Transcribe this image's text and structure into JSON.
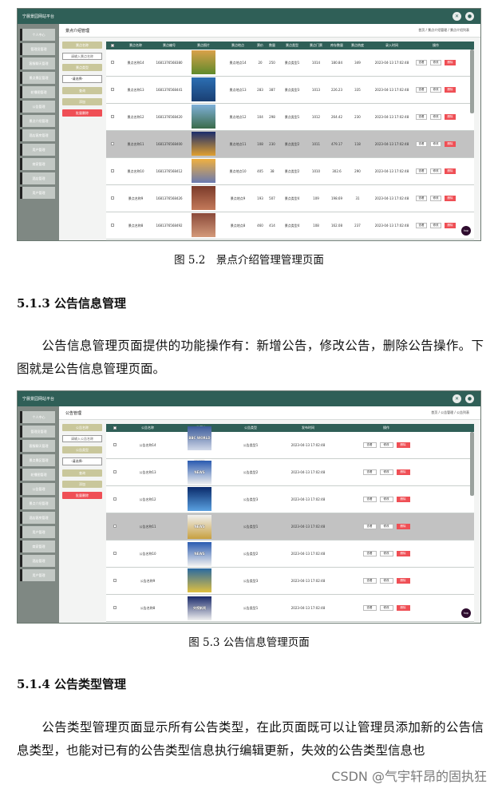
{
  "shot1": {
    "app_title": "宁晨景园网站平台",
    "sidebar": [
      "个人中心",
      "管理员管理",
      "客服聊天管理",
      "景点景区管理",
      "轮播图管理",
      "公告管理",
      "景点介绍管理",
      "酒店客房管理",
      "用户管理",
      "商家管理",
      "酒店管理",
      "用户管理"
    ],
    "page_title": "景点介绍管理",
    "breadcrumb": "首页 / 景点介绍管理 / 景点介绍列表",
    "controls": {
      "btn1": "景点名称",
      "input_placeholder": "请输入景点名称",
      "btn2": "景点类型",
      "select": "-请选择-",
      "btn3": "查询",
      "btn4": "添加",
      "btn5": "批量删除"
    },
    "headers": [
      "景点名称",
      "景点编号",
      "景点照片",
      "景点地点",
      "票价",
      "数量",
      "景点类型",
      "景点门票",
      "库存数量",
      "景点热度",
      "录入时间",
      "操作"
    ],
    "rows": [
      [
        "景点名称14",
        "1681376568380",
        "",
        "景点地点14",
        "20",
        "250",
        "景点类型1",
        "1014",
        "180.84",
        "349",
        "2023-04-13 17:02:48"
      ],
      [
        "景点名称13",
        "1681376568441",
        "",
        "景点地点13",
        "283",
        "387",
        "景点类型3",
        "1013",
        "226.23",
        "335",
        "2023-04-13 17:02:48"
      ],
      [
        "景点名称12",
        "1681376568420",
        "",
        "景点地点12",
        "104",
        "298",
        "景点类型1",
        "1012",
        "264.42",
        "230",
        "2023-04-13 17:02:48"
      ],
      [
        "景点名称11",
        "1681376568400",
        "",
        "景点地点11",
        "108",
        "230",
        "景点类型2",
        "1011",
        "479.17",
        "118",
        "2023-04-13 17:02:48"
      ],
      [
        "景点名称10",
        "1681376568412",
        "",
        "景点地点10",
        "405",
        "38",
        "景点类型2",
        "1010",
        "302.6",
        "290",
        "2023-04-13 17:02:48"
      ],
      [
        "景点名称9",
        "1681376568426",
        "",
        "景点地点9",
        "193",
        "507",
        "景点类型4",
        "109",
        "198.69",
        "31",
        "2023-04-13 17:02:48"
      ],
      [
        "景点名称8",
        "1681376568492",
        "",
        "景点地点8",
        "460",
        "414",
        "景点类型4",
        "108",
        "162.08",
        "237",
        "2023-04-13 17:02:48"
      ]
    ],
    "actions": {
      "view": "查看",
      "edit": "修改",
      "delete": "删除"
    },
    "fab": "top"
  },
  "caption1": "图 5.2　景点介绍管理管理页面",
  "heading1": "5.1.3  公告信息管理",
  "para1": "公告信息管理页面提供的功能操作有：新增公告，修改公告，删除公告操作。下图就是公告信息管理页面。",
  "shot2": {
    "app_title": "宁晨景园网站平台",
    "sidebar": [
      "个人中心",
      "管理员管理",
      "客服聊天管理",
      "景点景区管理",
      "轮播图管理",
      "公告管理",
      "景点介绍管理",
      "酒店客房管理",
      "用户管理",
      "商家管理",
      "酒店管理",
      "用户管理"
    ],
    "page_title": "公告管理",
    "breadcrumb": "首页 / 公告管理 / 公告列表",
    "controls": {
      "btn1": "公告名称",
      "input_placeholder": "请输入公告名称",
      "btn2": "公告类型",
      "select": "-请选择-",
      "btn3": "查询",
      "btn4": "添加",
      "btn5": "批量删除"
    },
    "headers": [
      "公告名称",
      "公告图片",
      "公告类型",
      "发布时间",
      "操作"
    ],
    "rows": [
      [
        "公告名称14",
        "BBC WORLD NEWS",
        "公告类型1",
        "2023-04-13 17:02:48"
      ],
      [
        "公告名称13",
        "NEWS",
        "公告类型2",
        "2023-04-13 17:02:48"
      ],
      [
        "公告名称12",
        "",
        "公告类型3",
        "2023-04-13 17:02:48"
      ],
      [
        "公告名称11",
        "NEWS",
        "公告类型1",
        "2023-04-13 17:02:48"
      ],
      [
        "公告名称10",
        "NEWS",
        "公告类型2",
        "2023-04-13 17:02:48"
      ],
      [
        "公告名称9",
        "",
        "公告类型3",
        "2023-04-13 17:02:48"
      ],
      [
        "公告名称8",
        "央视新闻",
        "公告类型1",
        "2023-04-13 17:02:48"
      ]
    ],
    "actions": {
      "view": "查看",
      "edit": "修改",
      "delete": "删除"
    },
    "fab": "top"
  },
  "caption2": "图 5.3  公告信息管理页面",
  "heading2": "5.1.4 公告类型管理",
  "para2": "公告类型管理页面显示所有公告类型，在此页面既可以让管理员添加新的公告信息类型，也能对已有的公告类型信息执行编辑更新，失效的公告类型信息也",
  "watermark": "CSDN @气宇轩昂的固执狂"
}
